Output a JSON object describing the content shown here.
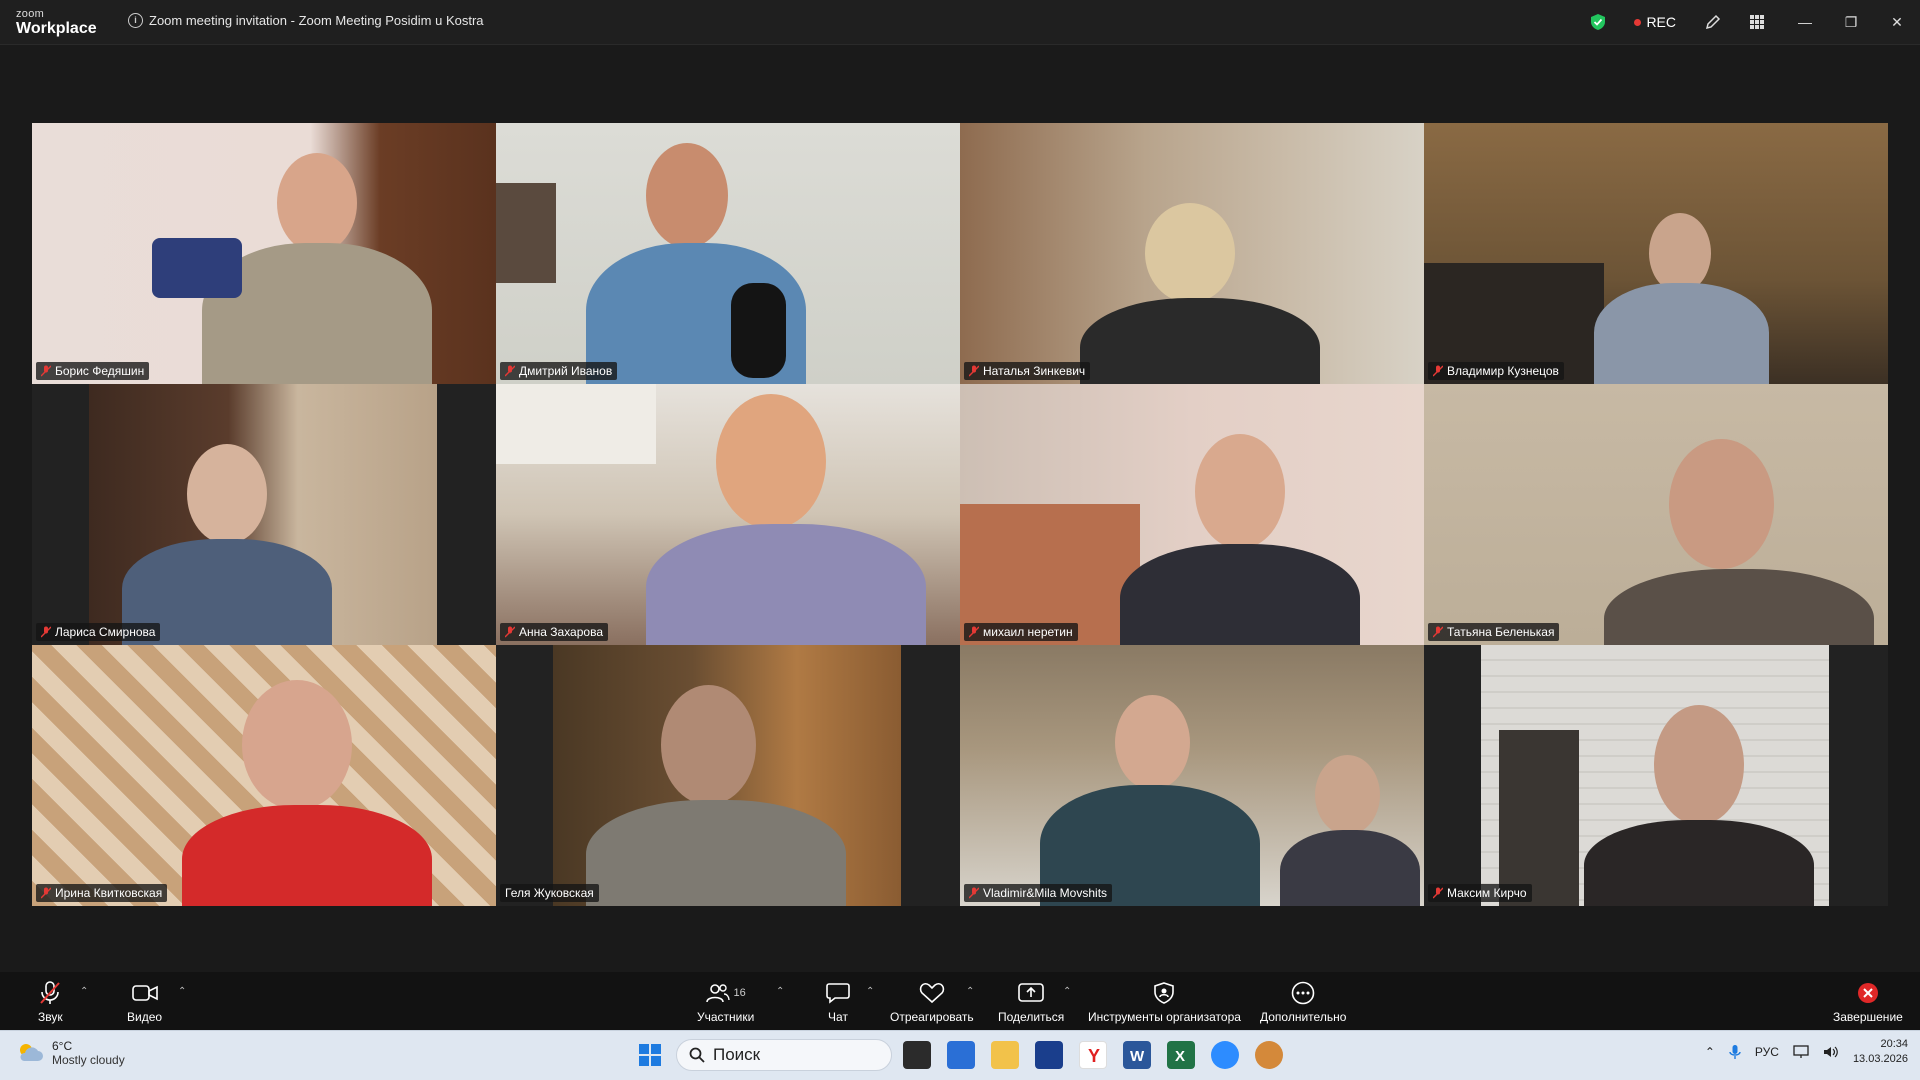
{
  "window": {
    "logo_small": "zoom",
    "logo_big": "Workplace",
    "meeting_title": "Zoom meeting invitation - Zoom Meeting Posidim u Kostra",
    "rec_label": "REC"
  },
  "participants": [
    {
      "name": "Борис Федяшин",
      "muted": true
    },
    {
      "name": "Дмитрий Иванов",
      "muted": true
    },
    {
      "name": "Наталья Зинкевич",
      "muted": true
    },
    {
      "name": "Владимир Кузнецов",
      "muted": true
    },
    {
      "name": "Лариса Смирнова",
      "muted": true
    },
    {
      "name": "Анна Захарова",
      "muted": true
    },
    {
      "name": "михаил неретин",
      "muted": true
    },
    {
      "name": "Татьяна Беленькая",
      "muted": true
    },
    {
      "name": "Ирина Квитковская",
      "muted": true
    },
    {
      "name": "Геля Жуковская",
      "muted": false,
      "active_speaker": true
    },
    {
      "name": "Vladimir&Mila Movshits",
      "muted": true
    },
    {
      "name": "Максим Кирчо",
      "muted": true
    }
  ],
  "toolbar": {
    "audio": "Звук",
    "video": "Видео",
    "participants": "Участники",
    "participants_count": "16",
    "chat": "Чат",
    "react": "Отреагировать",
    "share": "Поделиться",
    "host_tools": "Инструменты организатора",
    "more": "Дополнительно",
    "end": "Завершение"
  },
  "taskbar": {
    "temperature": "6°C",
    "weather": "Mostly cloudy",
    "search": "Поиск",
    "language": "РУС",
    "time": "20:34",
    "date": "13.03.2026"
  },
  "colors": {
    "active_speaker_border": "#2ebd7b",
    "rec_dot": "#e53935",
    "muted_icon": "#e53935",
    "end_button": "#e02828"
  }
}
